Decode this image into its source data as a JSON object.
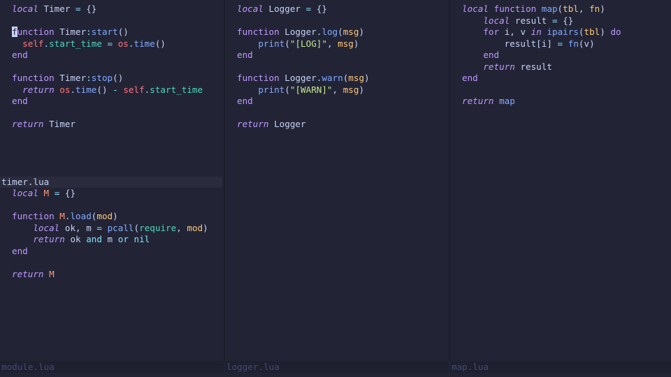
{
  "panes": [
    {
      "id": "timer",
      "lines": [
        "local Timer = {}",
        "",
        "function Timer:start()",
        "  self.start_time = os.time()",
        "end",
        "",
        "function Timer:stop()",
        "  return os.time() - self.start_time",
        "end",
        "",
        "return Timer"
      ],
      "filename": "timer.lua"
    },
    {
      "id": "module",
      "lines": [
        "local M = {}",
        "",
        "function M.load(mod)",
        "    local ok, m = pcall(require, mod)",
        "    return ok and m or nil",
        "end",
        "",
        "return M"
      ],
      "filename": "module.lua"
    },
    {
      "id": "logger",
      "lines": [
        "local Logger = {}",
        "",
        "function Logger.log(msg)",
        "    print(\"[LOG]\", msg)",
        "end",
        "",
        "function Logger.warn(msg)",
        "    print(\"[WARN]\", msg)",
        "end",
        "",
        "return Logger"
      ],
      "filename": "logger.lua"
    },
    {
      "id": "map",
      "lines": [
        "local function map(tbl, fn)",
        "    local result = {}",
        "    for i, v in ipairs(tbl) do",
        "        result[i] = fn(v)",
        "    end",
        "    return result",
        "end",
        "",
        "return map"
      ],
      "filename": "map.lua"
    }
  ],
  "colors": {
    "background": "#222436",
    "foreground": "#c8d3f5",
    "keyword": "#c099ff",
    "function": "#82aaff",
    "operator": "#86e1fc",
    "string": "#c3e88d",
    "self": "#ff757f",
    "property": "#4fd6be",
    "module": "#ff966c",
    "parameter": "#ffc777",
    "statusline_inactive": "#444a73"
  }
}
